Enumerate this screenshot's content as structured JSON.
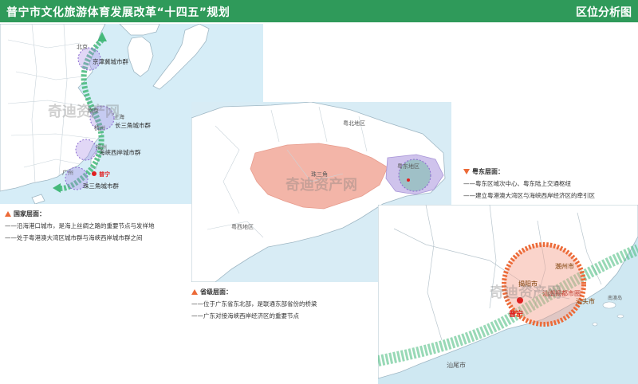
{
  "header": {
    "title": "普宁市文化旅游体育发展改革“十四五”规划",
    "section": "区位分析图"
  },
  "watermark": "奇迪资产网",
  "national_map": {
    "clusters": [
      "京津冀城市群",
      "长三角城市群",
      "海峡西岸城市群",
      "珠三角城市群"
    ],
    "place_labels": [
      "北京",
      "南京",
      "上海",
      "杭州",
      "福州",
      "广州"
    ],
    "puning_label": "普宁"
  },
  "national_note": {
    "title": "国家层面：",
    "lines": [
      "——沿海港口城市，是海上丝绸之路的重要节点与发祥地",
      "——处于粤港澳大湾区城市群与海峡西岸城市群之间"
    ]
  },
  "province_map": {
    "region_labels": [
      "粤北地区",
      "粤东地区",
      "珠三角",
      "粤西地区"
    ]
  },
  "province_note": {
    "title": "省级层面：",
    "lines": [
      "——位于广东省东北部，是联通东部省份的桥梁",
      "——广东对接海峡西岸经济区的重要节点"
    ]
  },
  "east_note": {
    "title": "粤东层面：",
    "lines": [
      "——粤东区域次中心、粤东陆上交通枢纽",
      "——建立粤港澳大湾区与海峡西岸经济区的牵引区"
    ]
  },
  "east_map": {
    "cities": [
      "潮州市",
      "揭阳市",
      "汕头市",
      "汕尾市"
    ],
    "circle_label": "汕潮揭都市圈",
    "puning_label": "普宁",
    "island_label": "南澳岛"
  },
  "colors": {
    "header_green": "#2f9a5a",
    "accent_orange": "#ec6a37",
    "corridor_green": "#44b97a",
    "sea": "#d6edf7",
    "land": "#ffffff",
    "pink_region": "#f3b5a8",
    "puning_red": "#e02020"
  }
}
